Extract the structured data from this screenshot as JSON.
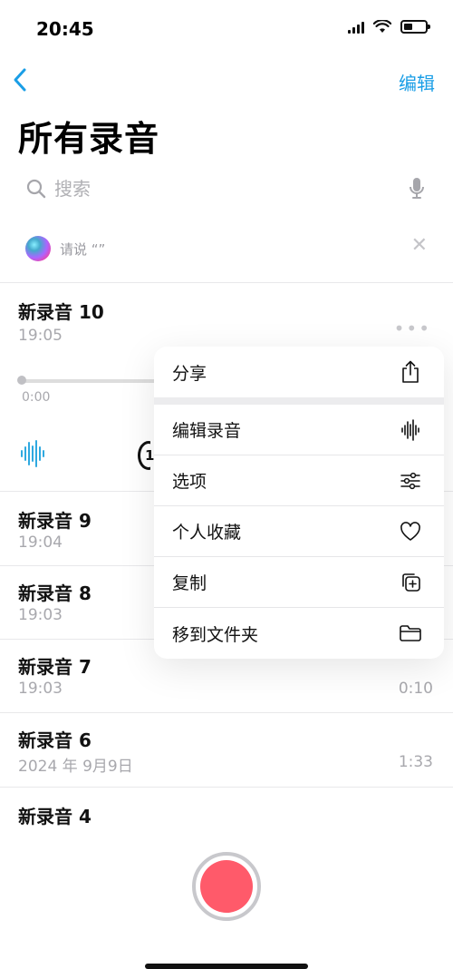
{
  "status_bar": {
    "time": "20:45",
    "battery_level": 0.4
  },
  "nav": {
    "edit_label": "编辑"
  },
  "page": {
    "title": "所有录音"
  },
  "search": {
    "placeholder": "搜索"
  },
  "siri": {
    "hint": "请说 “”"
  },
  "recordings": [
    {
      "title": "新录音 10",
      "time": "19:05",
      "duration": ""
    },
    {
      "title": "新录音 9",
      "time": "19:04",
      "duration": ""
    },
    {
      "title": "新录音 8",
      "time": "19:03",
      "duration": ""
    },
    {
      "title": "新录音 7",
      "time": "19:03",
      "duration": "0:10"
    },
    {
      "title": "新录音 6",
      "time": "2024 年 9月9日",
      "duration": "1:33"
    },
    {
      "title": "新录音 4",
      "time": "",
      "duration": ""
    }
  ],
  "player": {
    "current_time": "0:00",
    "skip_label": "1"
  },
  "menu": {
    "share": "分享",
    "edit_recording": "编辑录音",
    "options": "选项",
    "favorite": "个人收藏",
    "duplicate": "复制",
    "move_to_folder": "移到文件夹"
  },
  "colors": {
    "accent": "#1a9ee6",
    "record": "#ff5a6a"
  },
  "icons": {
    "back": "chevron-left-icon",
    "search": "search-icon",
    "mic": "microphone-icon",
    "share": "share-icon",
    "waveform": "waveform-icon",
    "options": "sliders-icon",
    "favorite": "heart-icon",
    "duplicate": "duplicate-icon",
    "folder": "folder-icon"
  }
}
